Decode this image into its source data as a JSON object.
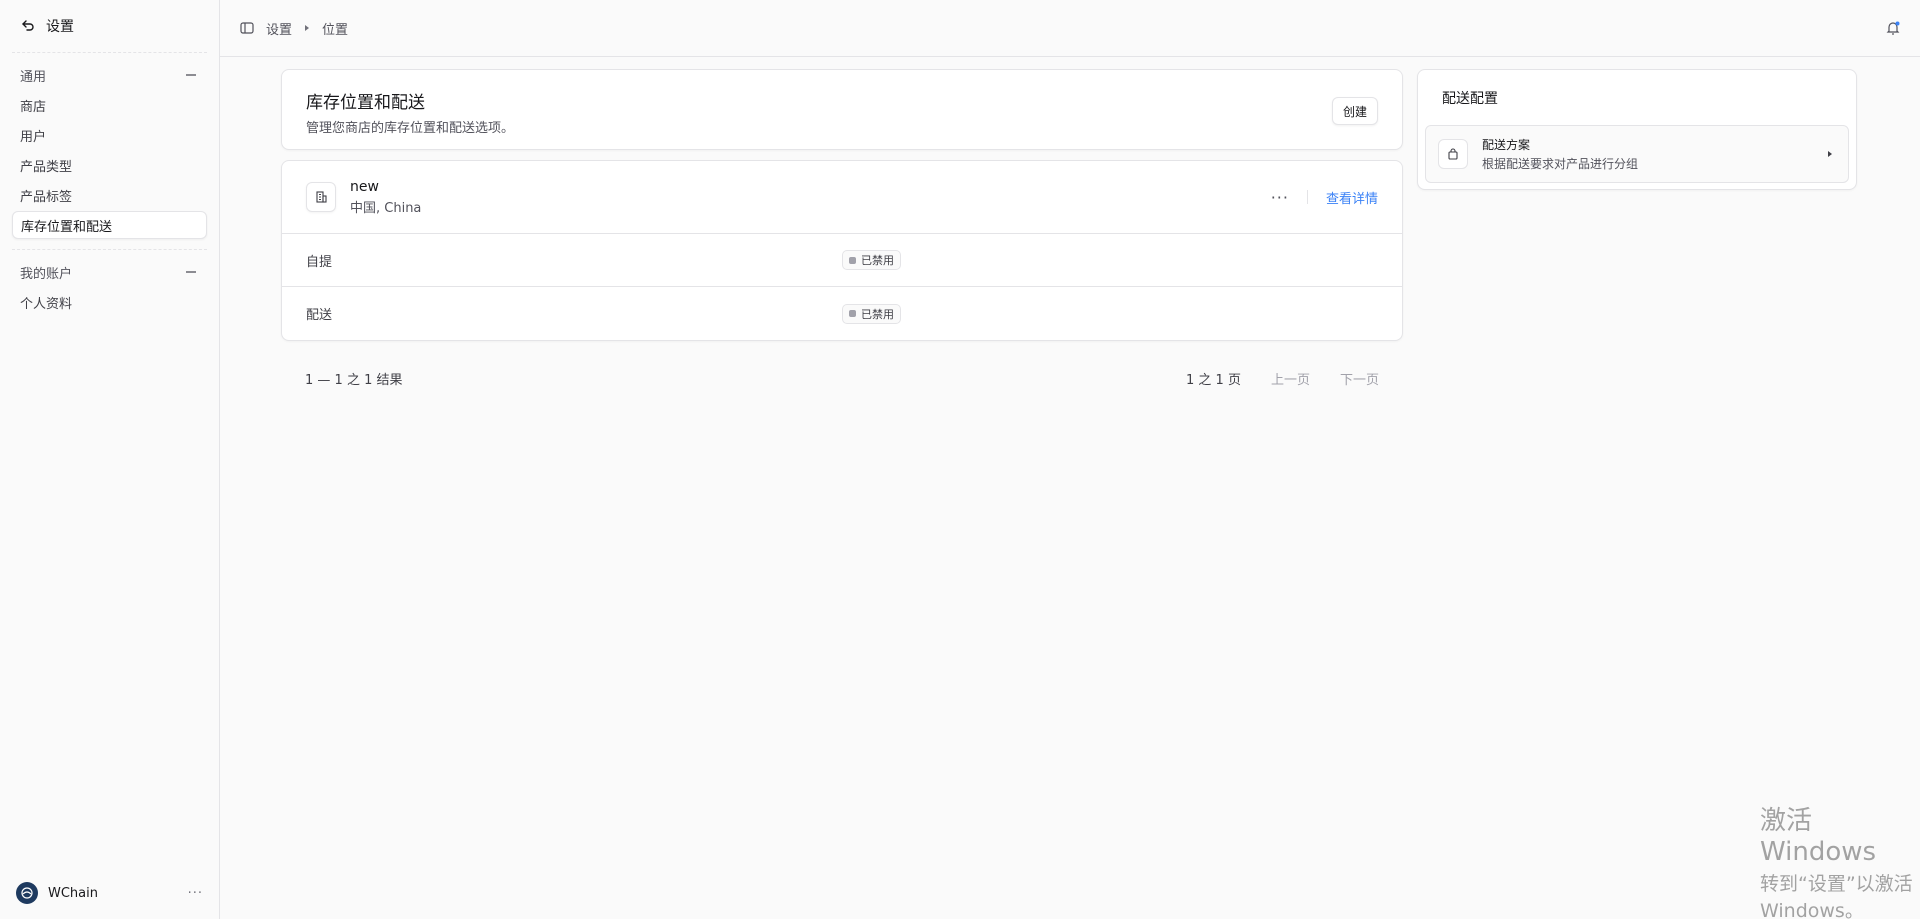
{
  "sidebar": {
    "header": {
      "title": "设置"
    },
    "groups": [
      {
        "title": "通用",
        "items": [
          "商店",
          "用户",
          "产品类型",
          "产品标签",
          "库存位置和配送"
        ],
        "active": "库存位置和配送"
      },
      {
        "title": "我的账户",
        "items": [
          "个人资料"
        ]
      }
    ],
    "footer": {
      "store_name": "WChain",
      "more": "···"
    }
  },
  "topbar": {
    "crumbs": [
      "设置",
      "位置"
    ]
  },
  "header_card": {
    "title": "库存位置和配送",
    "subtitle": "管理您商店的库存位置和配送选项。",
    "create_label": "创建"
  },
  "location": {
    "name": "new",
    "address": "中国, China",
    "more": "···",
    "details_link": "查看详情",
    "options": [
      {
        "label": "自提",
        "status": "已禁用"
      },
      {
        "label": "配送",
        "status": "已禁用"
      }
    ]
  },
  "pagination": {
    "summary": "1 — 1 之 1 结果",
    "page_info": "1 之 1 页",
    "prev": "上一页",
    "next": "下一页"
  },
  "shipping_card": {
    "title": "配送配置",
    "item_title": "配送方案",
    "item_desc": "根据配送要求对产品进行分组"
  },
  "watermark": {
    "line1": "激活 Windows",
    "line2": "转到“设置”以激活 Windows。"
  },
  "colors": {
    "link": "#3b82f6",
    "border": "#e4e4e7",
    "background": "#fafafa"
  }
}
